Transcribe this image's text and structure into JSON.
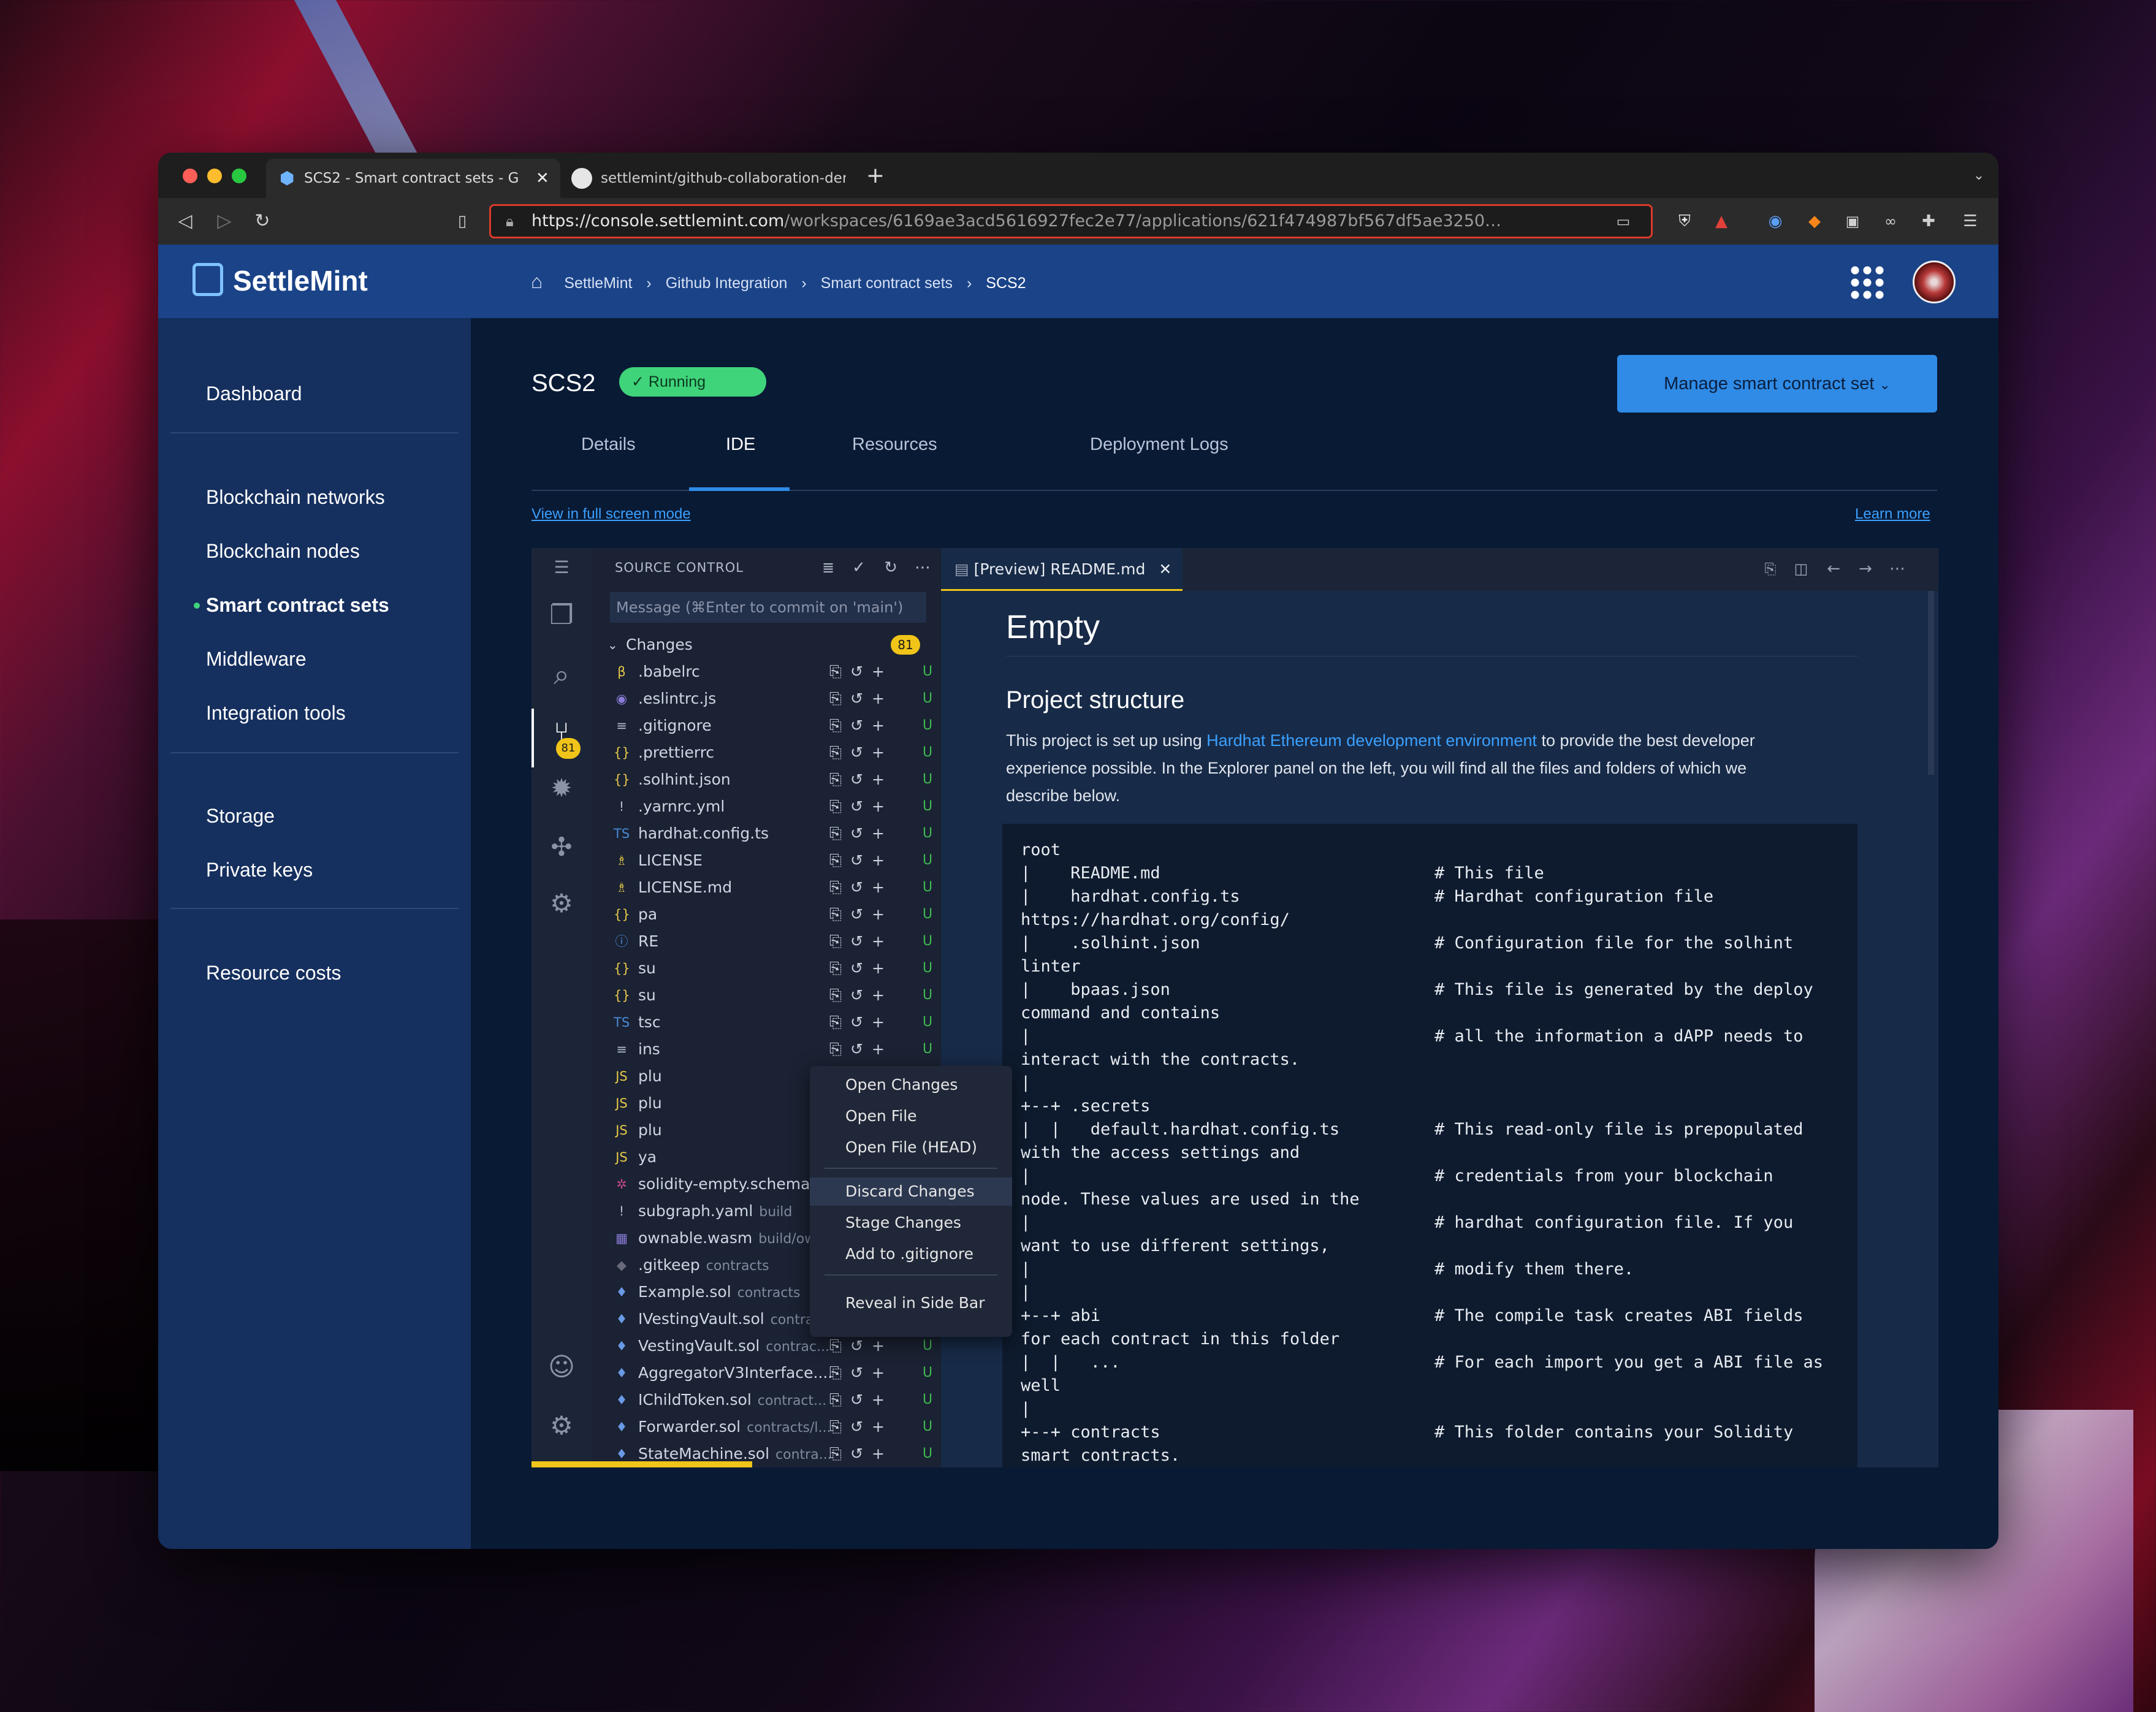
{
  "browser": {
    "tabs": [
      {
        "title": "SCS2 - Smart contract sets - G"
      },
      {
        "title": "settlemint/github-collaboration-den"
      }
    ],
    "new_tab": "+",
    "url_host": "https://console.settlemint.com",
    "url_path": "/workspaces/6169ae3acd5616927fec2e77/applications/621f474987bf567df5ae3250…",
    "colors": {
      "close": "#ff5f57",
      "minimize": "#febc2e",
      "maximize": "#28c840"
    }
  },
  "header": {
    "logo": "SettleMint",
    "breadcrumb": [
      "SettleMint",
      "Github Integration",
      "Smart contract sets",
      "SCS2"
    ]
  },
  "sidebar": {
    "items": [
      "Dashboard",
      "Blockchain networks",
      "Blockchain nodes",
      "Smart contract sets",
      "Middleware",
      "Integration tools",
      "Storage",
      "Private keys",
      "Resource costs"
    ],
    "active": "Smart contract sets"
  },
  "page": {
    "title": "SCS2",
    "status": "Running",
    "manage_button": "Manage smart contract set",
    "tabs": [
      "Details",
      "IDE",
      "Resources",
      "Deployment Logs"
    ],
    "active_tab": "IDE",
    "full_screen_link": "View in full screen mode",
    "learn_more": "Learn more"
  },
  "ide": {
    "scm_title": "SOURCE CONTROL",
    "commit_placeholder": "Message (⌘Enter to commit on 'main')",
    "changes_label": "Changes",
    "changes_count": "81",
    "badge": "81",
    "files": [
      {
        "icon": "β",
        "name": ".babelrc",
        "dir": ""
      },
      {
        "icon": "◉",
        "name": ".eslintrc.js",
        "dir": ""
      },
      {
        "icon": "≡",
        "name": ".gitignore",
        "dir": ""
      },
      {
        "icon": "{}",
        "name": ".prettierrc",
        "dir": ""
      },
      {
        "icon": "{}",
        "name": ".solhint.json",
        "dir": ""
      },
      {
        "icon": "!",
        "name": ".yarnrc.yml",
        "dir": ""
      },
      {
        "icon": "TS",
        "name": "hardhat.config.ts",
        "dir": ""
      },
      {
        "icon": "♗",
        "name": "LICENSE",
        "dir": ""
      },
      {
        "icon": "♗",
        "name": "LICENSE.md",
        "dir": ""
      },
      {
        "icon": "{}",
        "name": "pa",
        "dir": ""
      },
      {
        "icon": "ⓘ",
        "name": "RE",
        "dir": ""
      },
      {
        "icon": "{}",
        "name": "su",
        "dir": ""
      },
      {
        "icon": "{}",
        "name": "su",
        "dir": ""
      },
      {
        "icon": "TS",
        "name": "tsc",
        "dir": ""
      },
      {
        "icon": "≡",
        "name": "ins",
        "dir": ""
      },
      {
        "icon": "JS",
        "name": "plu",
        "dir": ""
      },
      {
        "icon": "JS",
        "name": "plu",
        "dir": ""
      },
      {
        "icon": "JS",
        "name": "plu",
        "dir": ""
      },
      {
        "icon": "JS",
        "name": "ya",
        "dir": ""
      },
      {
        "icon": "✲",
        "name": "solidity-empty.schema...",
        "dir": ""
      },
      {
        "icon": "!",
        "name": "subgraph.yaml",
        "dir": "build"
      },
      {
        "icon": "▦",
        "name": "ownable.wasm",
        "dir": "build/own..."
      },
      {
        "icon": "◆",
        "name": ".gitkeep",
        "dir": "contracts"
      },
      {
        "icon": "♦",
        "name": "Example.sol",
        "dir": "contracts"
      },
      {
        "icon": "♦",
        "name": "IVestingVault.sol",
        "dir": "contra..."
      },
      {
        "icon": "♦",
        "name": "VestingVault.sol",
        "dir": "contrac..."
      },
      {
        "icon": "♦",
        "name": "AggregatorV3Interface....",
        "dir": ""
      },
      {
        "icon": "♦",
        "name": "IChildToken.sol",
        "dir": "contract..."
      },
      {
        "icon": "♦",
        "name": "Forwarder.sol",
        "dir": "contracts/l..."
      },
      {
        "icon": "♦",
        "name": "StateMachine.sol",
        "dir": "contra..."
      }
    ],
    "file_status": "U",
    "context_menu": [
      "Open Changes",
      "Open File",
      "Open File (HEAD)",
      "Discard Changes",
      "Stage Changes",
      "Add to .gitignore",
      "Reveal in Side Bar"
    ],
    "editor_tab": "[Preview] README.md",
    "readme": {
      "h1": "Empty",
      "h2": "Project structure",
      "p_before": "This project is set up using ",
      "p_link": "Hardhat Ethereum development environment",
      "p_after": " to provide the best developer",
      "p_line2": "experience possible. In the Explorer panel on the left, you will find all the files and folders of which we",
      "p_line3": "describe below.",
      "code_left": [
        "root",
        "|    README.md",
        "|    hardhat.config.ts",
        "https://hardhat.org/config/",
        "|    .solhint.json",
        "linter",
        "|    bpaas.json",
        "command and contains",
        "|",
        "interact with the contracts.",
        "|",
        "+--+ .secrets",
        "|  |   default.hardhat.config.ts",
        "with the access settings and",
        "|",
        "node. These values are used in the",
        "|",
        "want to use different settings,",
        "|",
        "|",
        "+--+ abi",
        "for each contract in this folder",
        "|  |   ...",
        "well",
        "|",
        "+--+ contracts",
        "smart contracts."
      ],
      "code_right": [
        "",
        "# This file",
        "# Hardhat configuration file",
        "",
        "# Configuration file for the solhint",
        "",
        "# This file is generated by the deploy",
        "",
        "# all the information a dAPP needs to",
        "",
        "",
        "",
        "# This read-only file is prepopulated",
        "",
        "# credentials from your blockchain",
        "",
        "# hardhat configuration file. If you",
        "",
        "# modify them there.",
        "",
        "# The compile task creates ABI fields",
        "",
        "# For each import you get a ABI file as",
        "",
        "",
        "# This folder contains your Solidity",
        ""
      ]
    }
  }
}
